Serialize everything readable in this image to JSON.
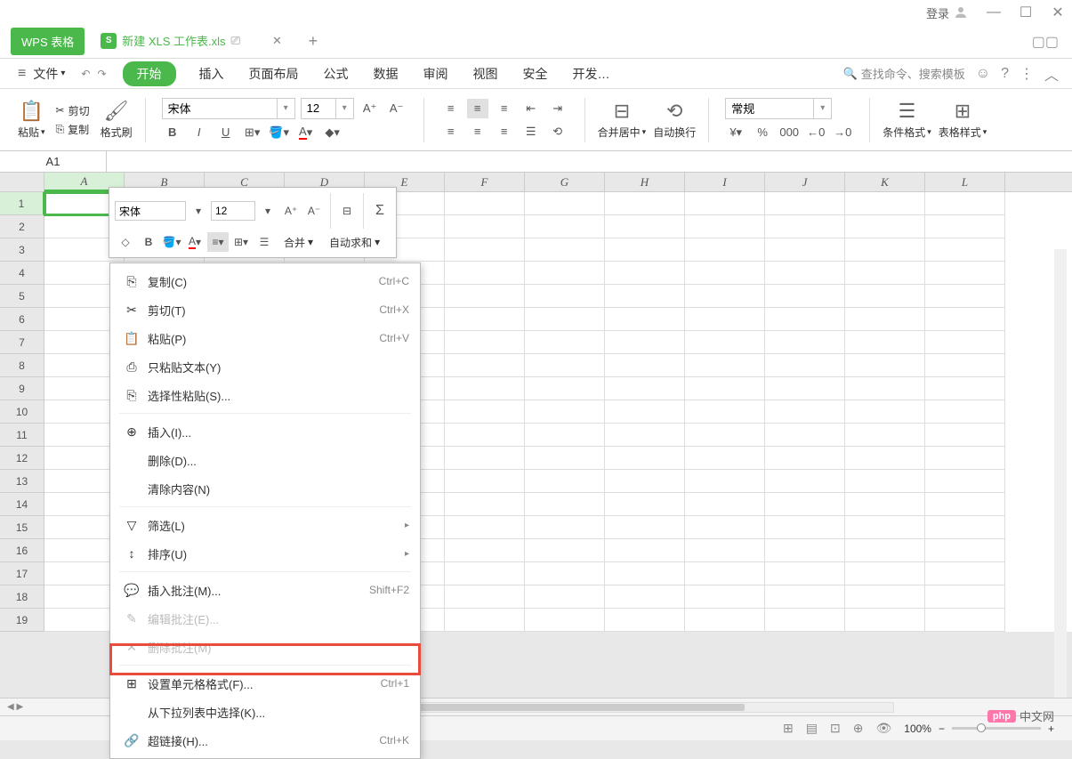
{
  "titlebar": {
    "login": "登录"
  },
  "tabbar": {
    "wps_label": "WPS 表格",
    "active_tab": "新建 XLS 工作表.xls"
  },
  "menubar": {
    "file": "文件",
    "start": "开始",
    "tabs": [
      "插入",
      "页面布局",
      "公式",
      "数据",
      "审阅",
      "视图",
      "安全",
      "开发…"
    ],
    "search_placeholder": "查找命令、搜索模板"
  },
  "toolbar": {
    "cut": "剪切",
    "paste": "粘贴",
    "copy": "复制",
    "format_painter": "格式刷",
    "font_name": "宋体",
    "font_size": "12",
    "merge_center": "合并居中",
    "wrap_text": "自动换行",
    "number_format": "常规",
    "conditional_format": "条件格式",
    "table_style": "表格样式"
  },
  "mini_toolbar": {
    "font_name": "宋体",
    "font_size": "12",
    "merge": "合并",
    "autosum": "自动求和"
  },
  "cellbar": {
    "reference": "A1"
  },
  "columns": [
    "A",
    "B",
    "C",
    "D",
    "E",
    "F",
    "G",
    "H",
    "I",
    "J",
    "K",
    "L"
  ],
  "rows": [
    1,
    2,
    3,
    4,
    5,
    6,
    7,
    8,
    9,
    10,
    11,
    12,
    13,
    14,
    15,
    16,
    17,
    18,
    19
  ],
  "context_menu": {
    "copy": {
      "label": "复制(C)",
      "shortcut": "Ctrl+C"
    },
    "cut": {
      "label": "剪切(T)",
      "shortcut": "Ctrl+X"
    },
    "paste": {
      "label": "粘贴(P)",
      "shortcut": "Ctrl+V"
    },
    "paste_text": {
      "label": "只粘贴文本(Y)"
    },
    "paste_special": {
      "label": "选择性粘贴(S)..."
    },
    "insert": {
      "label": "插入(I)..."
    },
    "delete": {
      "label": "删除(D)..."
    },
    "clear": {
      "label": "清除内容(N)"
    },
    "filter": {
      "label": "筛选(L)"
    },
    "sort": {
      "label": "排序(U)"
    },
    "insert_comment": {
      "label": "插入批注(M)...",
      "shortcut": "Shift+F2"
    },
    "edit_comment": {
      "label": "编辑批注(E)..."
    },
    "delete_comment": {
      "label": "删除批注(M)"
    },
    "format_cells": {
      "label": "设置单元格格式(F)...",
      "shortcut": "Ctrl+1"
    },
    "dropdown_select": {
      "label": "从下拉列表中选择(K)..."
    },
    "hyperlink": {
      "label": "超链接(H)...",
      "shortcut": "Ctrl+K"
    }
  },
  "statusbar": {
    "zoom": "100%"
  },
  "watermark": {
    "text": "中文网"
  }
}
